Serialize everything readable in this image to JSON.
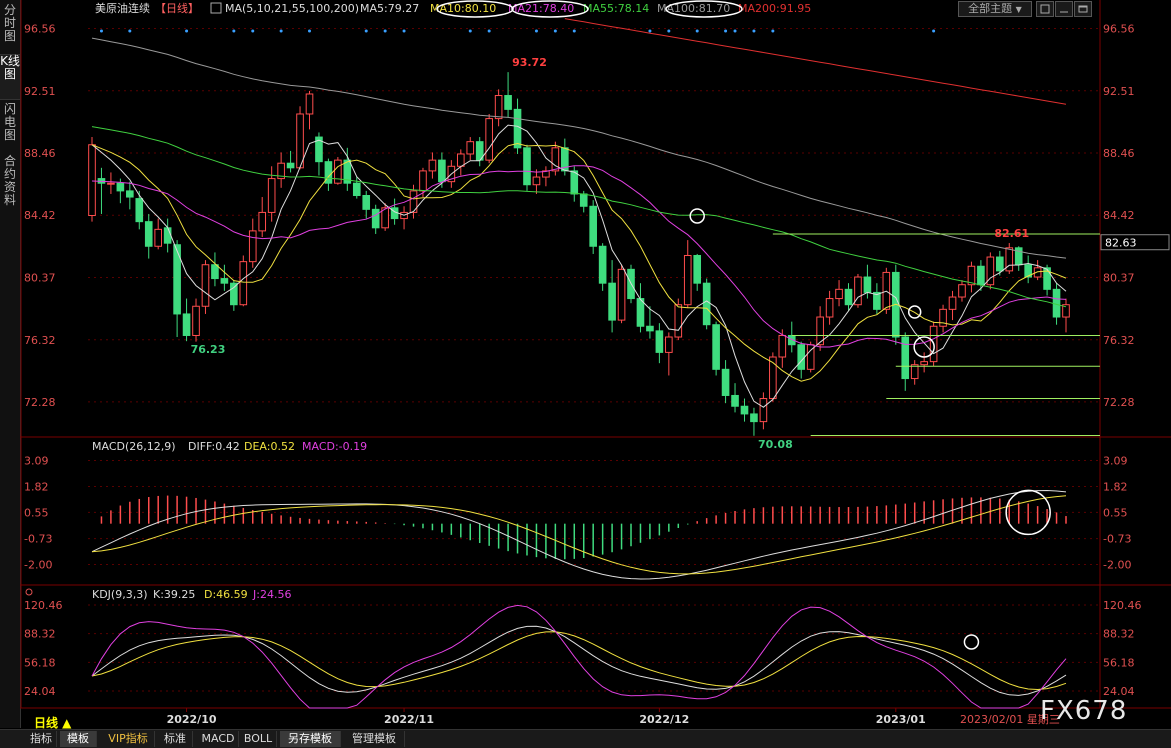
{
  "sidebar": {
    "tabs": [
      {
        "label": "分时图",
        "active": false
      },
      {
        "label": "K线图",
        "active": true
      },
      {
        "label": "闪电图",
        "active": false
      },
      {
        "label": "合约资料",
        "active": false
      }
    ]
  },
  "header": {
    "title": "美原油连续",
    "period": "【日线】",
    "ma_params": "MA(5,10,21,55,100,200)",
    "ma_values": [
      {
        "label": "MA5:79.27",
        "color": "#dddddd"
      },
      {
        "label": "MA10:80.10",
        "color": "#f0e040"
      },
      {
        "label": "MA21:78.40",
        "color": "#e040e0"
      },
      {
        "label": "MA55:78.14",
        "color": "#40d040"
      },
      {
        "label": "MA100:81.70",
        "color": "#999999"
      },
      {
        "label": "MA200:91.95",
        "color": "#e03030"
      }
    ]
  },
  "toolbar": {
    "theme_label": "全部主题",
    "theme_caret": "▼"
  },
  "icons": {
    "ma_icon": "grid-icon",
    "restore": "restore-icon",
    "minimize": "minimize-icon",
    "maximize": "maximize-icon",
    "tools": "tools-icon"
  },
  "chart_data": [
    {
      "type": "candlestick",
      "panel": "price",
      "y_ticks": [
        "96.56",
        "92.51",
        "88.46",
        "84.42",
        "80.37",
        "76.32",
        "72.28"
      ],
      "ylim": [
        70.0,
        97.5
      ],
      "current_price": "82.63",
      "annotations": [
        {
          "text": "93.72",
          "x": "2022/11/07",
          "y": 93.72,
          "color": "#ff4040"
        },
        {
          "text": "76.23",
          "x": "2022/09/27",
          "y": 76.23,
          "color": "#40d080"
        },
        {
          "text": "70.08",
          "x": "2022/12/09",
          "y": 70.08,
          "color": "#40d080"
        },
        {
          "text": "82.61",
          "x": "2023/01/27",
          "y": 82.61,
          "color": "#ff4040"
        }
      ],
      "support_lines": [
        83.2,
        76.6,
        74.6,
        72.5,
        70.1
      ],
      "ohlc": [
        [
          84.4,
          89.5,
          84.0,
          89.0
        ],
        [
          86.8,
          87.5,
          84.5,
          86.5
        ],
        [
          86.5,
          87.2,
          85.8,
          86.5
        ],
        [
          86.5,
          86.8,
          85.2,
          86.0
        ],
        [
          86.0,
          86.6,
          84.8,
          85.6
        ],
        [
          85.5,
          86.0,
          83.5,
          84.0
        ],
        [
          84.0,
          84.5,
          81.6,
          82.4
        ],
        [
          82.4,
          84.2,
          82.2,
          83.5
        ],
        [
          83.6,
          84.2,
          82.0,
          82.6
        ],
        [
          82.5,
          82.8,
          76.5,
          78.0
        ],
        [
          78.0,
          79.0,
          76.23,
          76.6
        ],
        [
          76.6,
          79.0,
          76.2,
          78.5
        ],
        [
          78.5,
          81.5,
          78.0,
          81.2
        ],
        [
          81.2,
          82.0,
          79.8,
          80.3
        ],
        [
          80.3,
          81.2,
          79.5,
          80.0
        ],
        [
          80.0,
          80.2,
          78.2,
          78.6
        ],
        [
          78.6,
          81.8,
          78.5,
          81.4
        ],
        [
          81.4,
          84.2,
          81.0,
          83.4
        ],
        [
          83.4,
          85.6,
          83.0,
          84.6
        ],
        [
          84.6,
          87.6,
          84.0,
          86.8
        ],
        [
          86.8,
          88.5,
          86.2,
          87.8
        ],
        [
          87.8,
          88.6,
          87.2,
          87.5
        ],
        [
          87.5,
          91.5,
          87.4,
          91.0
        ],
        [
          91.0,
          92.5,
          90.0,
          92.3
        ],
        [
          89.5,
          89.8,
          87.0,
          87.9
        ],
        [
          87.9,
          88.1,
          86.0,
          86.5
        ],
        [
          86.5,
          88.2,
          86.4,
          88.0
        ],
        [
          88.0,
          88.8,
          86.0,
          86.5
        ],
        [
          86.5,
          86.9,
          85.5,
          85.7
        ],
        [
          85.7,
          86.0,
          84.2,
          84.8
        ],
        [
          84.8,
          85.1,
          83.2,
          83.6
        ],
        [
          83.6,
          85.2,
          83.4,
          84.9
        ],
        [
          84.9,
          85.5,
          83.8,
          84.2
        ],
        [
          84.2,
          85.0,
          83.5,
          84.6
        ],
        [
          84.6,
          86.4,
          84.2,
          86.0
        ],
        [
          86.0,
          87.5,
          85.6,
          87.3
        ],
        [
          87.3,
          88.5,
          86.8,
          88.0
        ],
        [
          88.0,
          88.5,
          86.2,
          86.6
        ],
        [
          86.6,
          88.0,
          86.2,
          87.6
        ],
        [
          87.6,
          88.7,
          87.0,
          88.4
        ],
        [
          88.4,
          89.5,
          88.0,
          89.2
        ],
        [
          89.2,
          89.5,
          87.6,
          88.0
        ],
        [
          88.0,
          91.0,
          87.8,
          90.7
        ],
        [
          90.7,
          92.6,
          90.2,
          92.2
        ],
        [
          92.2,
          93.72,
          90.8,
          91.3
        ],
        [
          91.3,
          92.0,
          88.4,
          88.8
        ],
        [
          88.8,
          89.0,
          86.0,
          86.4
        ],
        [
          86.4,
          87.4,
          85.8,
          86.9
        ],
        [
          86.9,
          87.6,
          86.3,
          87.3
        ],
        [
          87.3,
          89.2,
          87.0,
          88.8
        ],
        [
          88.8,
          89.4,
          87.0,
          87.3
        ],
        [
          87.3,
          87.6,
          85.3,
          85.8
        ],
        [
          85.8,
          86.0,
          84.6,
          85.0
        ],
        [
          85.0,
          85.4,
          81.9,
          82.4
        ],
        [
          82.4,
          82.6,
          79.5,
          80.0
        ],
        [
          80.0,
          81.5,
          76.8,
          77.6
        ],
        [
          77.6,
          81.2,
          77.4,
          80.9
        ],
        [
          80.9,
          81.2,
          78.7,
          79.0
        ],
        [
          79.0,
          80.0,
          76.8,
          77.2
        ],
        [
          77.2,
          78.5,
          76.4,
          76.9
        ],
        [
          76.9,
          77.4,
          74.8,
          75.5
        ],
        [
          75.5,
          76.8,
          74.0,
          76.5
        ],
        [
          76.5,
          79.0,
          76.3,
          78.6
        ],
        [
          78.6,
          82.8,
          78.4,
          81.8
        ],
        [
          81.8,
          81.9,
          79.5,
          80.0
        ],
        [
          80.0,
          80.3,
          77.0,
          77.3
        ],
        [
          77.3,
          77.5,
          74.0,
          74.4
        ],
        [
          74.4,
          75.0,
          72.2,
          72.7
        ],
        [
          72.7,
          73.5,
          71.6,
          72.0
        ],
        [
          72.0,
          72.5,
          71.0,
          71.5
        ],
        [
          71.5,
          71.9,
          70.08,
          71.0
        ],
        [
          71.0,
          72.9,
          70.5,
          72.5
        ],
        [
          72.5,
          75.5,
          72.3,
          75.2
        ],
        [
          75.2,
          77.0,
          74.5,
          76.6
        ],
        [
          76.6,
          77.5,
          75.5,
          76.0
        ],
        [
          76.0,
          76.2,
          73.8,
          74.4
        ],
        [
          74.4,
          76.2,
          74.2,
          76.0
        ],
        [
          76.0,
          78.5,
          75.6,
          77.8
        ],
        [
          77.8,
          79.5,
          77.3,
          79.0
        ],
        [
          79.0,
          80.2,
          78.5,
          79.6
        ],
        [
          79.6,
          80.0,
          78.2,
          78.6
        ],
        [
          78.6,
          80.6,
          78.4,
          80.4
        ],
        [
          80.4,
          81.2,
          79.0,
          79.4
        ],
        [
          79.4,
          80.0,
          78.0,
          78.3
        ],
        [
          78.3,
          81.0,
          78.0,
          80.7
        ],
        [
          80.7,
          81.2,
          76.0,
          76.5
        ],
        [
          76.5,
          76.8,
          73.0,
          73.8
        ],
        [
          73.8,
          75.0,
          73.4,
          74.7
        ],
        [
          74.7,
          75.5,
          74.2,
          74.9
        ],
        [
          74.9,
          77.5,
          74.6,
          77.2
        ],
        [
          77.2,
          78.6,
          76.8,
          78.3
        ],
        [
          78.3,
          79.5,
          77.6,
          79.1
        ],
        [
          79.1,
          80.2,
          78.8,
          79.9
        ],
        [
          79.9,
          81.4,
          79.4,
          81.1
        ],
        [
          81.1,
          81.5,
          79.5,
          79.9
        ],
        [
          79.9,
          82.0,
          79.6,
          81.7
        ],
        [
          81.7,
          82.1,
          80.5,
          80.8
        ],
        [
          80.8,
          82.61,
          80.6,
          82.3
        ],
        [
          82.3,
          82.4,
          80.8,
          81.2
        ],
        [
          81.2,
          81.8,
          80.0,
          80.4
        ],
        [
          80.4,
          81.5,
          80.2,
          81.0
        ],
        [
          81.0,
          81.2,
          79.2,
          79.6
        ],
        [
          79.6,
          80.0,
          77.3,
          77.8
        ],
        [
          77.8,
          79.0,
          76.8,
          78.6
        ]
      ],
      "series": [
        {
          "name": "MA5",
          "color": "#dddddd"
        },
        {
          "name": "MA10",
          "color": "#f0e040"
        },
        {
          "name": "MA21",
          "color": "#e040e0"
        },
        {
          "name": "MA55",
          "color": "#40d040"
        },
        {
          "name": "MA100",
          "color": "#999999"
        },
        {
          "name": "MA200",
          "color": "#e03030"
        }
      ]
    },
    {
      "type": "histogram",
      "panel": "macd",
      "title": "MACD(26,12,9)",
      "labels": [
        {
          "text": "DIFF:0.42",
          "color": "#dddddd"
        },
        {
          "text": "DEA:0.52",
          "color": "#f0e040"
        },
        {
          "text": "MACD:-0.19",
          "color": "#e040e0"
        }
      ],
      "y_ticks": [
        "3.09",
        "1.82",
        "0.55",
        "-0.73",
        "-2.00"
      ],
      "ylim": [
        -3.0,
        3.8
      ]
    },
    {
      "type": "line",
      "panel": "kdj",
      "title": "KDJ(9,3,3)",
      "labels": [
        {
          "text": "K:39.25",
          "color": "#dddddd"
        },
        {
          "text": "D:46.59",
          "color": "#f0e040"
        },
        {
          "text": "J:24.56",
          "color": "#e040e0"
        }
      ],
      "y_ticks": [
        "120.46",
        "88.32",
        "56.18",
        "24.04"
      ],
      "ylim": [
        5,
        135
      ]
    }
  ],
  "x_axis": {
    "labels": [
      "2022/10",
      "2022/11",
      "2022/12",
      "2023/01"
    ],
    "cursor_date": "2023/02/01 星期三",
    "period_label": "日线 ▲"
  },
  "bottom_tabs": [
    {
      "label": "指标",
      "active": false,
      "vip": false
    },
    {
      "label": "模板",
      "active": true,
      "vip": false
    },
    {
      "label": "VIP指标",
      "active": false,
      "vip": true
    },
    {
      "label": "标准",
      "active": false,
      "vip": false
    },
    {
      "label": "MACD",
      "active": false,
      "vip": false
    },
    {
      "label": "BOLL",
      "active": false,
      "vip": false
    },
    {
      "label": "另存模板",
      "active": true,
      "vip": false
    },
    {
      "label": "管理模板",
      "active": false,
      "vip": false
    }
  ],
  "watermark": "FX678"
}
